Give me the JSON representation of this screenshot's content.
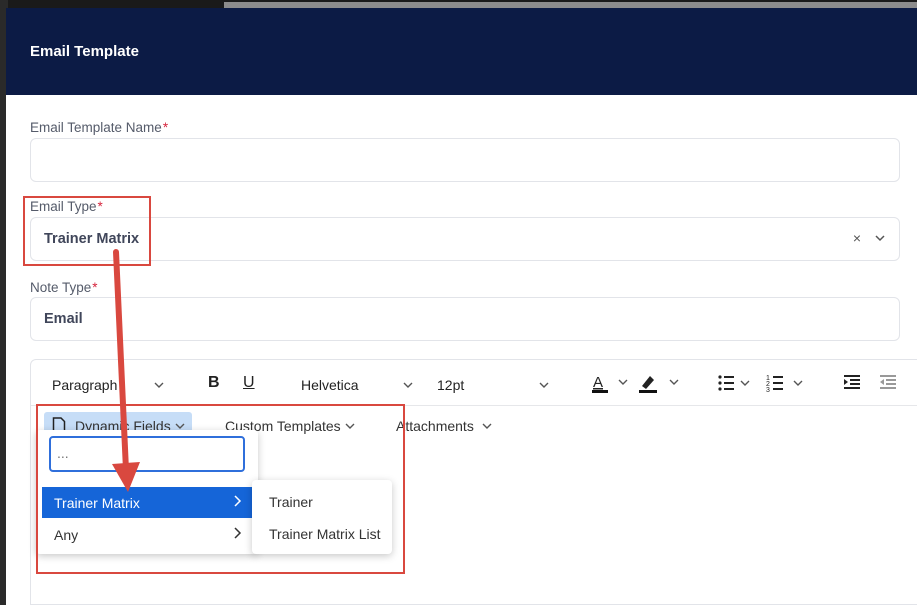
{
  "modal": {
    "title": "Email Template"
  },
  "fields": {
    "template_name": {
      "label": "Email Template Name",
      "required": "*",
      "value": ""
    },
    "email_type": {
      "label": "Email Type",
      "required": "*",
      "value": "Trainer Matrix",
      "clear": "×"
    },
    "note_type": {
      "label": "Note Type",
      "required": "*",
      "value": "Email"
    }
  },
  "toolbar": {
    "block_format": "Paragraph",
    "font_family": "Helvetica",
    "font_size": "12pt",
    "bold": "B",
    "underline": "U"
  },
  "menus": {
    "dynamic_fields": "Dynamic Fields",
    "custom_templates": "Custom Templates",
    "attachments": "Attachments"
  },
  "dropdown": {
    "search_placeholder": "...",
    "items": [
      {
        "label": "Trainer Matrix",
        "selected": true
      },
      {
        "label": "Any",
        "selected": false
      }
    ],
    "submenu": [
      {
        "label": "Trainer"
      },
      {
        "label": "Trainer Matrix List"
      }
    ]
  },
  "colors": {
    "header_bg": "#0c1b45",
    "selected_bg": "#1565d8",
    "annotation": "#d9483f",
    "required": "#d6243c"
  }
}
